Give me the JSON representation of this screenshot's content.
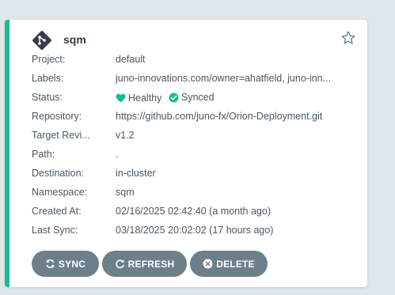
{
  "app": {
    "name": "sqm",
    "icon": "git-icon",
    "accent_color": "#18be94"
  },
  "details": [
    {
      "key": "Project:",
      "value": "default"
    },
    {
      "key": "Labels:",
      "value": "juno-innovations.com/owner=ahatfield, juno-inn..."
    },
    {
      "key": "Status:",
      "value": ""
    },
    {
      "key": "Repository:",
      "value": "https://github.com/juno-fx/Orion-Deployment.git"
    },
    {
      "key": "Target Revi...",
      "value": "v1.2"
    },
    {
      "key": "Path:",
      "value": "."
    },
    {
      "key": "Destination:",
      "value": "in-cluster"
    },
    {
      "key": "Namespace:",
      "value": "sqm"
    },
    {
      "key": "Created At:",
      "value": "02/16/2025 02:42:40  (a month ago)"
    },
    {
      "key": "Last Sync:",
      "value": "03/18/2025 20:02:02  (17 hours ago)"
    }
  ],
  "status": {
    "health": "Healthy",
    "health_icon": "heart-icon",
    "health_color": "#18be94",
    "sync": "Synced",
    "sync_icon": "check-circle-icon",
    "sync_color": "#18be94"
  },
  "actions": {
    "sync_label": "SYNC",
    "refresh_label": "REFRESH",
    "delete_label": "DELETE",
    "button_color": "#6d7f8b"
  }
}
